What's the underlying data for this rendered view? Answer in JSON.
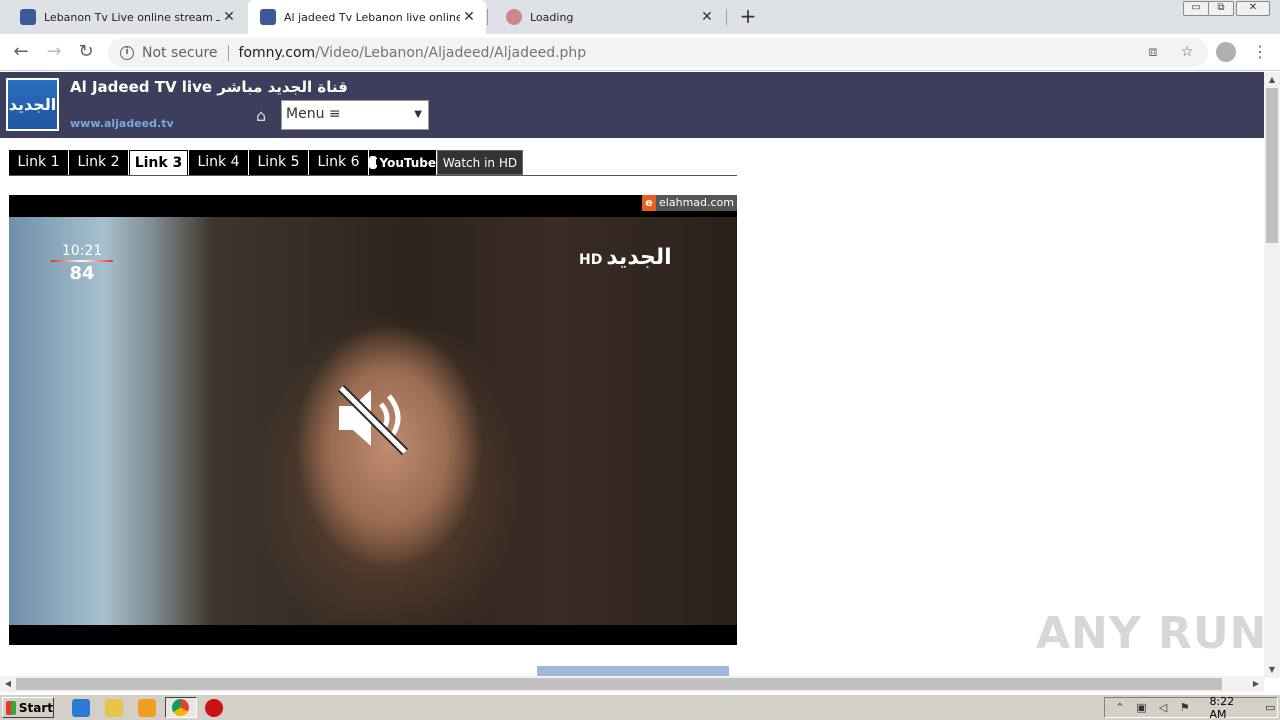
{
  "browser": {
    "tabs": [
      {
        "title": "Lebanon Tv Live online stream ساـ",
        "active": false
      },
      {
        "title": "Al jadeed Tv Lebanon live online stre",
        "active": true
      },
      {
        "title": "Loading",
        "active": false
      }
    ],
    "address": {
      "security_label": "Not secure",
      "host": "fomny.com",
      "path": "/Video/Lebanon/Aljadeed/Aljadeed.php"
    }
  },
  "site": {
    "logo_text": "الجديد",
    "title": "Al Jadeed TV live قناة الجديد مباشر",
    "url": "www.aljadeed.tv",
    "menu": {
      "selected": "Menu ≡"
    },
    "links": [
      "Link 1",
      "Link 2",
      "Link 3",
      "Link 4",
      "Link 5",
      "Link 6"
    ],
    "active_link": "Link 3",
    "youtube_label": "YouTube",
    "hd_label": "Watch in HD"
  },
  "video": {
    "watermark_letter": "e",
    "watermark": "elahmad.com",
    "clock": "10:21",
    "temperature": "84",
    "channel_logo": "الجديد",
    "channel_hd": "HD",
    "muted": true
  },
  "overlay": {
    "brand": "ANY RUN"
  },
  "taskbar": {
    "start_label": "Start",
    "time": "8:22 AM"
  },
  "colors": {
    "site_header": "#3c3e5b",
    "site_url": "#7aa9de",
    "tabstrip": "#dee1e6",
    "taskbar": "#d4d0c8"
  }
}
